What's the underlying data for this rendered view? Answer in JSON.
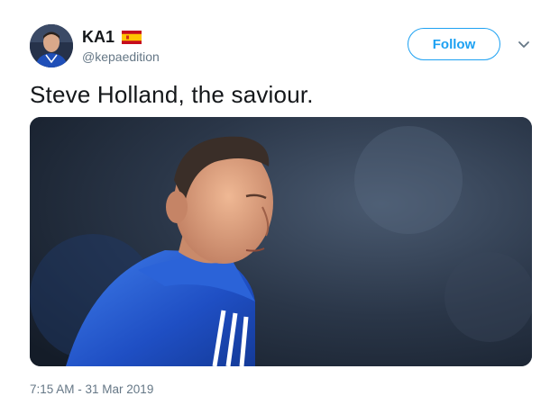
{
  "user": {
    "display_name": "KA1",
    "handle": "@kepaedition",
    "flag_icon": "spain-flag-icon",
    "avatar_icon": "profile-avatar"
  },
  "actions": {
    "follow_label": "Follow",
    "menu_icon": "chevron-down-icon"
  },
  "tweet": {
    "text": "Steve Holland, the saviour.",
    "timestamp": "7:15 AM - 31 Mar 2019",
    "media_icon": "photo-man-in-blue-jacket"
  },
  "colors": {
    "accent": "#1da1f2",
    "text": "#14171a",
    "muted": "#657786",
    "flag_red": "#c60b1e",
    "flag_yellow": "#ffc400"
  }
}
